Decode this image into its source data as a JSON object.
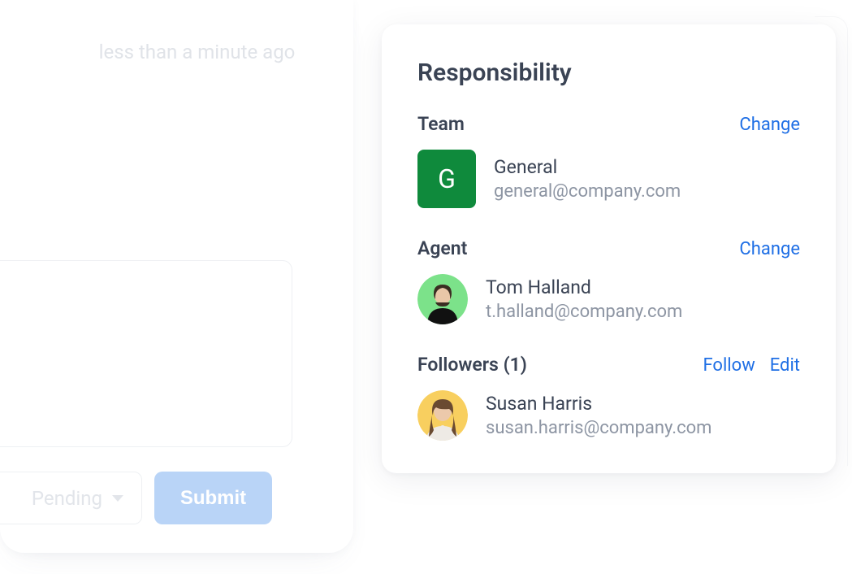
{
  "left": {
    "timestamp": "less than a minute ago",
    "status_label": "Pending",
    "submit_label": "Submit"
  },
  "panel": {
    "title": "Responsibility",
    "team": {
      "label": "Team",
      "change": "Change",
      "avatar_letter": "G",
      "avatar_bg": "#0f8a3c",
      "name": "General",
      "email": "general@company.com"
    },
    "agent": {
      "label": "Agent",
      "change": "Change",
      "name": "Tom Halland",
      "email": "t.halland@company.com",
      "avatar_bg": "#7ce28a"
    },
    "followers": {
      "label": "Followers (1)",
      "follow": "Follow",
      "edit": "Edit",
      "items": [
        {
          "name": "Susan Harris",
          "email": "susan.harris@company.com",
          "avatar_bg": "#f8cf5f"
        }
      ]
    }
  }
}
